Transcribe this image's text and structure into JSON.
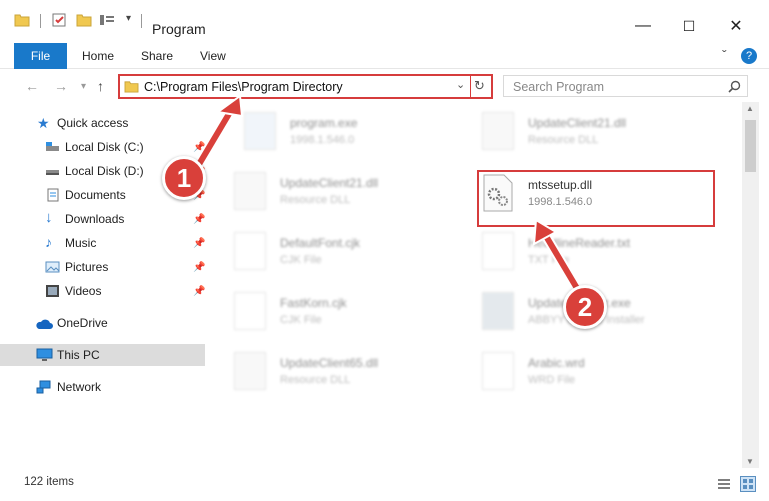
{
  "window": {
    "title": "Program",
    "minimize_glyph": "—",
    "maximize_glyph": "☐",
    "close_glyph": "✕"
  },
  "ribbon": {
    "tabs": [
      "File",
      "Home",
      "Share",
      "View"
    ],
    "collapse_glyph": "ˇ",
    "help_glyph": "?"
  },
  "address": {
    "path": "C:\\Program Files\\Program Directory",
    "search_placeholder": "Search Program"
  },
  "sidebar": {
    "items": [
      {
        "label": "Quick access",
        "icon": "star-icon",
        "pinned": false
      },
      {
        "label": "Local Disk (C:)",
        "icon": "drive-icon",
        "pinned": true
      },
      {
        "label": "Local Disk (D:)",
        "icon": "drive-icon",
        "pinned": true
      },
      {
        "label": "Documents",
        "icon": "documents-icon",
        "pinned": true
      },
      {
        "label": "Downloads",
        "icon": "download-icon",
        "pinned": true
      },
      {
        "label": "Music",
        "icon": "music-icon",
        "pinned": true
      },
      {
        "label": "Pictures",
        "icon": "pictures-icon",
        "pinned": true
      },
      {
        "label": "Videos",
        "icon": "videos-icon",
        "pinned": true
      },
      {
        "label": "OneDrive",
        "icon": "cloud-icon",
        "pinned": false
      },
      {
        "label": "This PC",
        "icon": "pc-icon",
        "pinned": false,
        "selected": true
      },
      {
        "label": "Network",
        "icon": "network-icon",
        "pinned": false
      }
    ]
  },
  "files": [
    {
      "name": "program.exe",
      "sub": "1998.1.546.0",
      "blurred": true
    },
    {
      "name": "UpdateClient21.dll",
      "sub": "Resource DLL",
      "blurred": true
    },
    {
      "name": "UpdateClient21.dll",
      "sub": "Resource DLL",
      "blurred": true
    },
    {
      "name": "mtssetup.dll",
      "sub": "1998.1.546.0",
      "blurred": false
    },
    {
      "name": "DefaultFont.cjk",
      "sub": "CJK File",
      "blurred": true
    },
    {
      "name": "HeadlineReader.txt",
      "sub": "TXT File",
      "blurred": true
    },
    {
      "name": "FastKorn.cjk",
      "sub": "CJK File",
      "blurred": true
    },
    {
      "name": "UpdateInstaller.exe",
      "sub": "ABBYY Update Installer",
      "blurred": true
    },
    {
      "name": "UpdateClient65.dll",
      "sub": "Resource DLL",
      "blurred": true
    },
    {
      "name": "Arabic.wrd",
      "sub": "WRD File",
      "blurred": true
    }
  ],
  "status": {
    "items_count": "122 items"
  },
  "callouts": {
    "first": "1",
    "second": "2"
  },
  "colors": {
    "accent": "#1979ca",
    "highlight": "#d63c3c",
    "callout": "#d9403a"
  }
}
